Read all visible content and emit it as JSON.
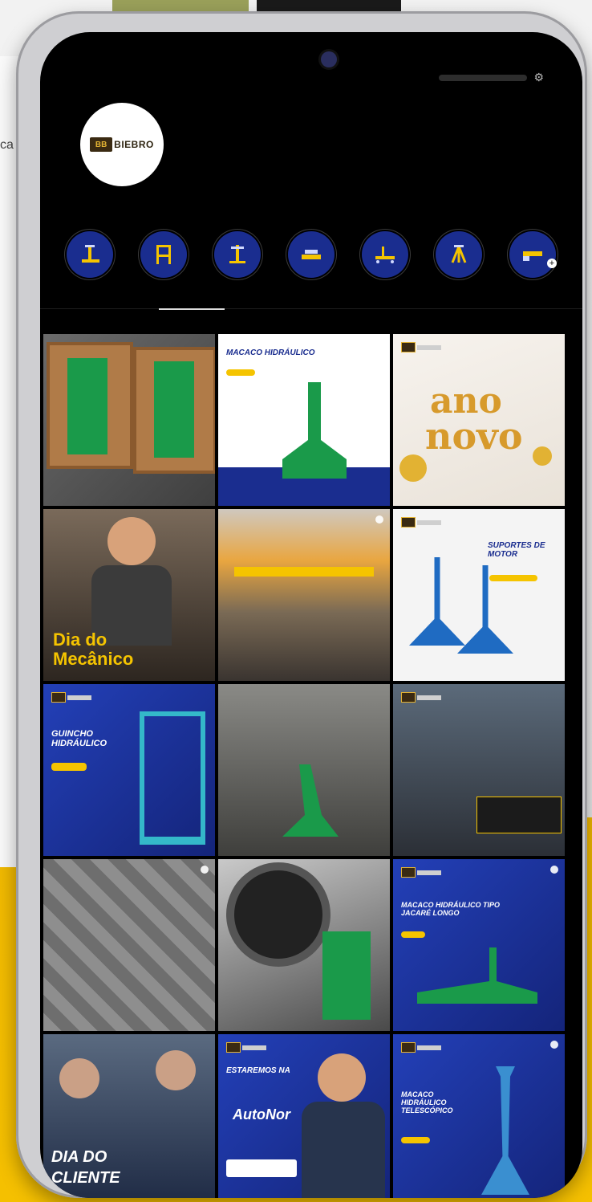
{
  "topbar": {
    "button_label": "",
    "settings_icon": "gear-icon"
  },
  "profile": {
    "logo_mark": "BB",
    "logo_text": "BIEBRO",
    "stats": [
      "",
      "",
      ""
    ],
    "name": "",
    "category": "",
    "bio_lines": [
      "",
      "",
      ""
    ]
  },
  "highlights": [
    {
      "label": "",
      "icon": "jack-icon"
    },
    {
      "label": "",
      "icon": "press-icon"
    },
    {
      "label": "",
      "icon": "stand-icon"
    },
    {
      "label": "",
      "icon": "lift-icon"
    },
    {
      "label": "",
      "icon": "creeper-icon"
    },
    {
      "label": "",
      "icon": "support-icon"
    },
    {
      "label": "",
      "icon": "tool-icon"
    }
  ],
  "tabs": [
    {
      "label": ""
    },
    {
      "label": ""
    },
    {
      "label": ""
    },
    {
      "label": ""
    }
  ],
  "posts": [
    {
      "headline": "",
      "sub": ""
    },
    {
      "headline": "MACACO HIDRÁULICO",
      "sub": ""
    },
    {
      "headline": "ano",
      "sub": "novo"
    },
    {
      "headline": "Dia do",
      "sub": "Mecânico"
    },
    {
      "headline": "",
      "sub": ""
    },
    {
      "headline": "SUPORTES DE MOTOR",
      "sub": ""
    },
    {
      "headline": "GUINCHO HIDRÁULICO",
      "sub": ""
    },
    {
      "headline": "",
      "sub": ""
    },
    {
      "headline": "",
      "sub": ""
    },
    {
      "headline": "",
      "sub": ""
    },
    {
      "headline": "",
      "sub": ""
    },
    {
      "headline": "MACACO HIDRÁULICO TIPO JACARÉ LONGO",
      "sub": ""
    },
    {
      "headline": "DIA DO",
      "sub": "CLIENTE"
    },
    {
      "headline": "ESTAREMOS NA",
      "sub": "AutoNor"
    },
    {
      "headline": "MACACO HIDRÁULICO TELESCÓPICO",
      "sub": ""
    }
  ],
  "colors": {
    "brand_blue": "#1a2d8f",
    "brand_yellow": "#f5c400",
    "equipment_green": "#1a9a4a"
  }
}
